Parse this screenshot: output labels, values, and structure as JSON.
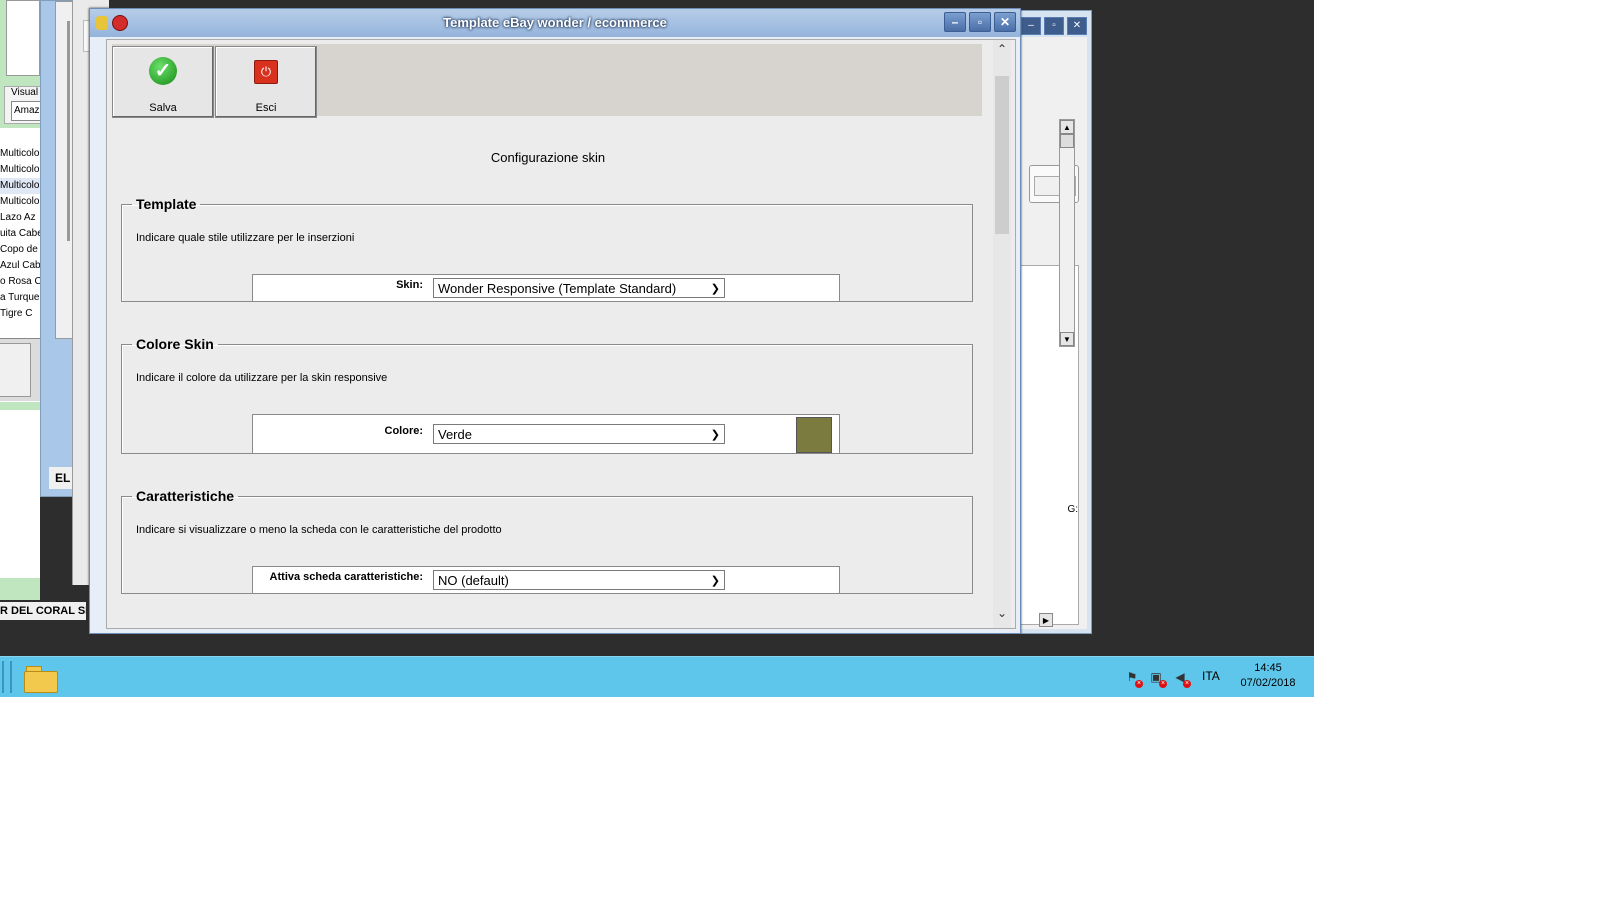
{
  "dialog": {
    "title": "Template eBay wonder / ecommerce",
    "controls": {
      "minimize": "–",
      "maximize": "▫",
      "close": "✕"
    }
  },
  "toolbar": {
    "save_label": "Salva",
    "exit_label": "Esci"
  },
  "config_title": "Configurazione skin",
  "sections": {
    "template": {
      "legend": "Template",
      "description": "Indicare quale stile utilizzare per le inserzioni",
      "field_label": "Skin:",
      "field_value": "Wonder Responsive (Template Standard)"
    },
    "color": {
      "legend": "Colore Skin",
      "description": "Indicare il colore da utilizzare per la skin responsive",
      "field_label": "Colore:",
      "field_value": "Verde",
      "swatch_color": "#7b7a3f"
    },
    "features": {
      "legend": "Caratteristiche",
      "description": "Indicare si visualizzare o meno la scheda con le caratteristiche del prodotto",
      "field_label": "Attiva scheda caratteristiche:",
      "field_value": "NO (default)"
    }
  },
  "background_app": {
    "group_label": "Visual",
    "group_input": "Amaz",
    "list_items": [
      "Multicolo",
      "Multicolo",
      "Multicolo",
      "Multicolo",
      "Lazo Az",
      "uita Cabe",
      "Copo de",
      "Azul Cab",
      "o Rosa C",
      "a Turque",
      "Tigre C"
    ],
    "middle_label": "EL",
    "status_text": "R DEL CORAL SL",
    "right_partial_text": "G:"
  },
  "taskbar": {
    "language": "ITA",
    "time": "14:45",
    "date": "07/02/2018"
  },
  "colors": {
    "taskbar": "#5dc6ea",
    "title_bar": "#95b4dc",
    "desktop": "#2d2d2d"
  }
}
